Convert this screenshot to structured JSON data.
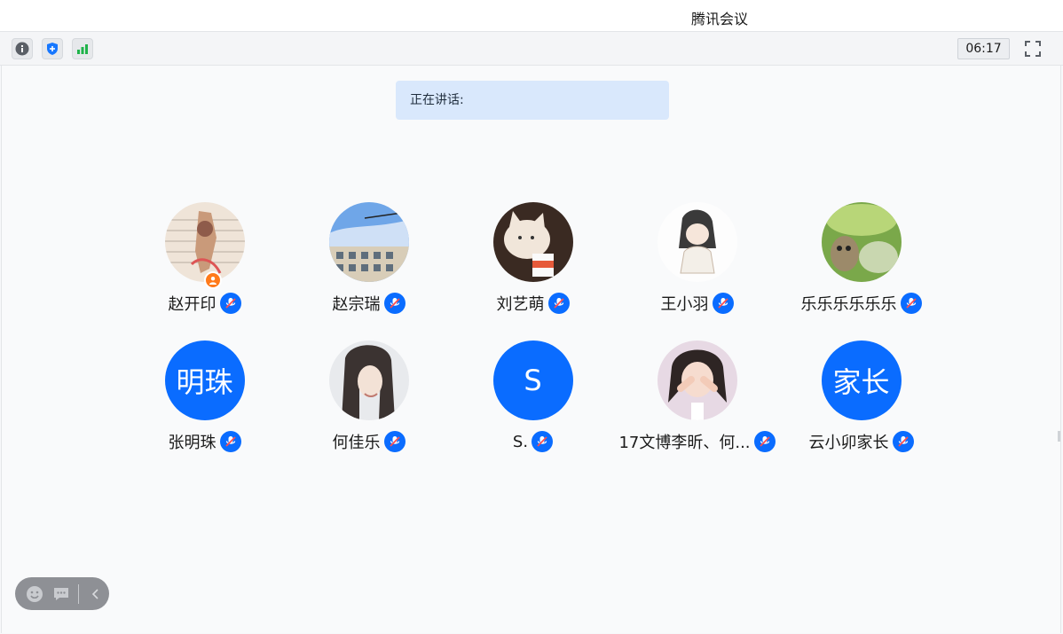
{
  "app": {
    "title": "腾讯会议"
  },
  "toolbar": {
    "icons": [
      "info-icon",
      "shield-icon",
      "signal-icon"
    ],
    "timer": "06:17",
    "fullscreen_icon": "fullscreen-icon"
  },
  "speaking": {
    "label": "正在讲话:"
  },
  "participants": [
    {
      "name": "赵开印",
      "avatar": "photo",
      "host": true
    },
    {
      "name": "赵宗瑞",
      "avatar": "photo"
    },
    {
      "name": "刘艺萌",
      "avatar": "photo"
    },
    {
      "name": "王小羽",
      "avatar": "photo"
    },
    {
      "name": "乐乐乐乐乐乐",
      "avatar": "photo"
    },
    {
      "name": "张明珠",
      "avatar": "text",
      "avatar_text": "明珠"
    },
    {
      "name": "何佳乐",
      "avatar": "photo"
    },
    {
      "name": "S.",
      "avatar": "text",
      "avatar_text": "S"
    },
    {
      "name": "17文博李昕、何...",
      "avatar": "photo"
    },
    {
      "name": "云小卯家长",
      "avatar": "text",
      "avatar_text": "家长"
    }
  ],
  "floating_bar": {
    "icons": [
      "emoji-icon",
      "chat-icon",
      "collapse-icon"
    ]
  },
  "colors": {
    "accent": "#0a6cff",
    "speaking_bg": "#d9e8fc",
    "host_badge": "#ff7a1a",
    "signal": "#1fb34a"
  }
}
